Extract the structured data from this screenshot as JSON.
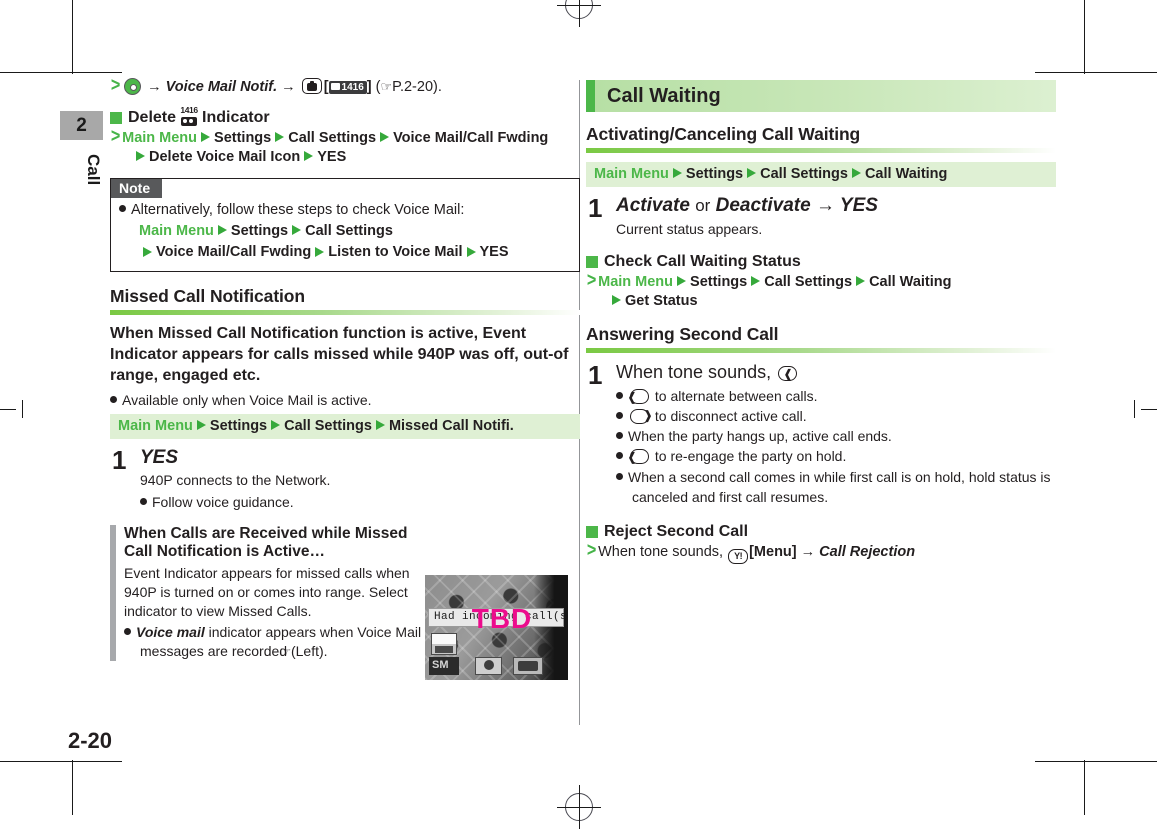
{
  "page": {
    "folio": "2-20",
    "chapter_number": "2",
    "chapter_label": "Call"
  },
  "colors": {
    "green_accent": "#4cb749",
    "path_bar_bg": "#dff0d4",
    "section_band": "#b6dfa4",
    "note_header_bg": "#58595b",
    "callout_bar": "#a7a9ac",
    "tbd_magenta": "#ec0c8c"
  },
  "left_column": {
    "intro_line": {
      "chevron": ">",
      "key_icon": "center-key-icon",
      "arrow1": "→",
      "menu_item": "Voice Mail Notif.",
      "arrow2": "→",
      "camera_icon": "camera-key-icon",
      "bracket_open": "[",
      "indicator_chip": "1416",
      "bracket_close": "]",
      "ref_open": "(",
      "ref_hand": "☞",
      "ref_text": "P.2-20",
      "ref_close": ")."
    },
    "delete_indicator": {
      "heading_pre": "Delete",
      "heading_icon": "voice-mail-indicator-icon",
      "heading_icon_number": "1416",
      "heading_post": "Indicator",
      "path_line_1": [
        "Main Menu",
        "Settings",
        "Call Settings",
        "Voice Mail/Call Fwding"
      ],
      "path_line_2": [
        "Delete Voice Mail Icon",
        "YES"
      ]
    },
    "note": {
      "header": "Note",
      "bullet_text": "Alternatively, follow these steps to check Voice Mail:",
      "path_line_1": [
        "Main Menu",
        "Settings",
        "Call Settings"
      ],
      "path_line_2": [
        "Voice Mail/Call Fwding",
        "Listen to Voice Mail",
        "YES"
      ]
    },
    "missed_call": {
      "heading": "Missed Call Notification",
      "body": "When Missed Call Notification function is active, Event Indicator appears for calls missed while 940P was off, out-of range, engaged etc.",
      "bullet": "Available only when Voice Mail is active.",
      "path_bar": [
        "Main Menu",
        "Settings",
        "Call Settings",
        "Missed Call Notifi."
      ],
      "step": {
        "number": "1",
        "title": "YES",
        "desc": "940P connects to the Network.",
        "bullets": [
          "Follow voice guidance."
        ]
      }
    },
    "callout": {
      "title": "When Calls are Received while Missed Call Notification is Active…",
      "body": "Event Indicator appears for missed calls when 940P is turned on or comes into range. Select indicator to view Missed Calls.",
      "bullet_lead": "Voice mail",
      "bullet_rest": " indicator appears when Voice Mail messages are recorded (",
      "bullet_ref_hand": "☞",
      "bullet_ref": "Left).",
      "screenshot": {
        "message": "Had incoming call(s)",
        "overlay": "TBD"
      }
    }
  },
  "right_column": {
    "section_title": "Call Waiting",
    "activating": {
      "heading": "Activating/Canceling Call Waiting",
      "path_bar": [
        "Main Menu",
        "Settings",
        "Call Settings",
        "Call Waiting"
      ],
      "step": {
        "number": "1",
        "title_a": "Activate",
        "title_or": "or",
        "title_b": "Deactivate",
        "title_arrow": "→",
        "title_c": "YES",
        "desc": "Current status appears."
      }
    },
    "check_status": {
      "heading": "Check Call Waiting Status",
      "path_line_1": [
        "Main Menu",
        "Settings",
        "Call Settings",
        "Call Waiting"
      ],
      "path_line_2": [
        "Get Status"
      ]
    },
    "answering": {
      "heading": "Answering Second Call",
      "step": {
        "number": "1",
        "title": "When tone sounds,",
        "title_icon": "send-key-icon",
        "bullets": [
          {
            "icon": "send-key-icon",
            "text": "to alternate between calls."
          },
          {
            "icon": "end-key-icon",
            "text": "to disconnect active call."
          },
          {
            "icon": null,
            "text": "When the party hangs up, active call ends."
          },
          {
            "icon": "send-key-icon",
            "text": "to re-engage the party on hold."
          },
          {
            "icon": null,
            "text": "When a second call comes in while first call is on hold, hold status is canceled and first call resumes."
          }
        ]
      }
    },
    "reject": {
      "heading": "Reject Second Call",
      "line_pre": "When tone sounds,",
      "soft_key_icon": "Y!",
      "menu_label": "[Menu]",
      "arrow": "→",
      "action": "Call Rejection"
    }
  }
}
